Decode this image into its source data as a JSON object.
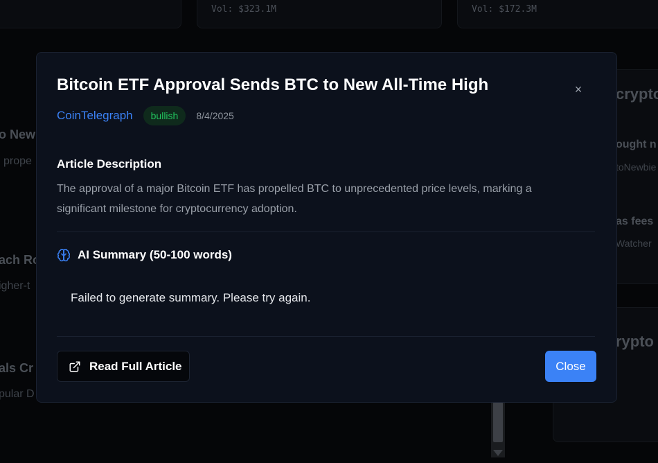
{
  "background": {
    "volumes": [
      "Vol: $323.1M",
      "Vol: $172.3M"
    ],
    "left_snippets": [
      "o New",
      "prope",
      "ach Ro",
      "igher-t",
      "als Cr",
      "pular D"
    ],
    "right_snippets": [
      "crypto",
      "ought n",
      "toNewbie",
      "as fees",
      "Watcher",
      "rypto T"
    ]
  },
  "modal": {
    "title": "Bitcoin ETF Approval Sends BTC to New All-Time High",
    "source": "CoinTelegraph",
    "sentiment": "bullish",
    "date": "8/4/2025",
    "description_heading": "Article Description",
    "description": "The approval of a major Bitcoin ETF has propelled BTC to unprecedented price levels, marking a significant milestone for cryptocurrency adoption.",
    "ai_heading": "AI Summary (50-100 words)",
    "summary": "Failed to generate summary. Please try again.",
    "read_button": "Read Full Article",
    "close_button": "Close",
    "close_icon": "×",
    "outer_close_icon": "×"
  },
  "colors": {
    "accent": "#3b82f6",
    "bullish": "#22c55e",
    "modal_bg": "#0c111c"
  },
  "icons": {
    "ai": "brain-icon",
    "read": "external-link-icon",
    "close": "close-icon"
  }
}
